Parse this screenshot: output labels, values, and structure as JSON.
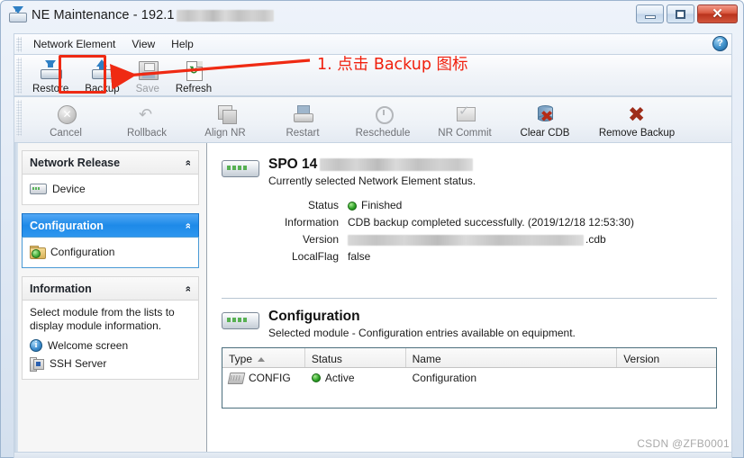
{
  "window": {
    "title_prefix": "NE Maintenance - 192.1",
    "title_redacted": true,
    "icon": "ne-maintenance-icon",
    "controls": {
      "minimize": "–",
      "maximize": "▣",
      "close": "✕"
    }
  },
  "menubar": {
    "items": [
      {
        "label": "Network Element"
      },
      {
        "label": "View"
      },
      {
        "label": "Help"
      }
    ],
    "help_icon": "?"
  },
  "toolbar_primary": {
    "buttons": [
      {
        "label": "Restore",
        "icon": "restore-icon",
        "enabled": true,
        "highlighted": false
      },
      {
        "label": "Backup",
        "icon": "backup-icon",
        "enabled": true,
        "highlighted": true
      },
      {
        "label": "Save",
        "icon": "save-icon",
        "enabled": false,
        "highlighted": false
      },
      {
        "label": "Refresh",
        "icon": "refresh-icon",
        "enabled": true,
        "highlighted": false
      }
    ]
  },
  "toolbar_secondary": {
    "buttons": [
      {
        "label": "Cancel",
        "icon": "cancel-icon",
        "enabled": false
      },
      {
        "label": "Rollback",
        "icon": "rollback-icon",
        "enabled": false
      },
      {
        "label": "Align NR",
        "icon": "align-nr-icon",
        "enabled": false
      },
      {
        "label": "Restart",
        "icon": "restart-icon",
        "enabled": false
      },
      {
        "label": "Reschedule",
        "icon": "reschedule-icon",
        "enabled": false
      },
      {
        "label": "NR Commit",
        "icon": "nr-commit-icon",
        "enabled": false
      },
      {
        "label": "Clear CDB",
        "icon": "clear-cdb-icon",
        "enabled": true
      },
      {
        "label": "Remove Backup",
        "icon": "remove-backup-icon",
        "enabled": true
      }
    ]
  },
  "annotation": {
    "text": "1. 点击 Backup 图标",
    "color": "#f01f0c",
    "highlight_target": "Backup"
  },
  "sidebar": {
    "groups": [
      {
        "title": "Network Release",
        "active": false,
        "collapse_glyph": "»",
        "items": [
          {
            "label": "Device",
            "icon": "device-icon"
          }
        ]
      },
      {
        "title": "Configuration",
        "active": true,
        "collapse_glyph": "»",
        "items": [
          {
            "label": "Configuration",
            "icon": "configuration-folder-icon"
          }
        ]
      },
      {
        "title": "Information",
        "active": false,
        "collapse_glyph": "»",
        "note": "Select module from the lists to display module information.",
        "items": [
          {
            "label": "Welcome screen",
            "icon": "info-icon"
          },
          {
            "label": "SSH Server",
            "icon": "ssh-server-icon"
          }
        ]
      }
    ]
  },
  "main": {
    "status_section": {
      "icon": "network-element-icon",
      "title": "SPO 14",
      "title_redacted": true,
      "subtitle": "Currently selected Network Element status.",
      "fields": [
        {
          "label": "Status",
          "value": "Finished",
          "indicator": "green-dot"
        },
        {
          "label": "Information",
          "value": "CDB backup completed successfully. (2019/12/18 12:53:30)"
        },
        {
          "label": "Version",
          "value": ".cdb",
          "redacted": true
        },
        {
          "label": "LocalFlag",
          "value": "false"
        }
      ]
    },
    "config_section": {
      "icon": "network-element-icon",
      "title": "Configuration",
      "subtitle": "Selected module - Configuration entries available on equipment.",
      "table": {
        "columns": [
          {
            "label": "Type",
            "sort": "asc"
          },
          {
            "label": "Status"
          },
          {
            "label": "Name"
          },
          {
            "label": "Version"
          }
        ],
        "rows": [
          {
            "type": "CONFIG",
            "type_icon": "chip-icon",
            "status": "Active",
            "status_indicator": "green-dot",
            "name": "Configuration",
            "version": ""
          }
        ]
      }
    }
  },
  "watermark": "CSDN @ZFB0001"
}
